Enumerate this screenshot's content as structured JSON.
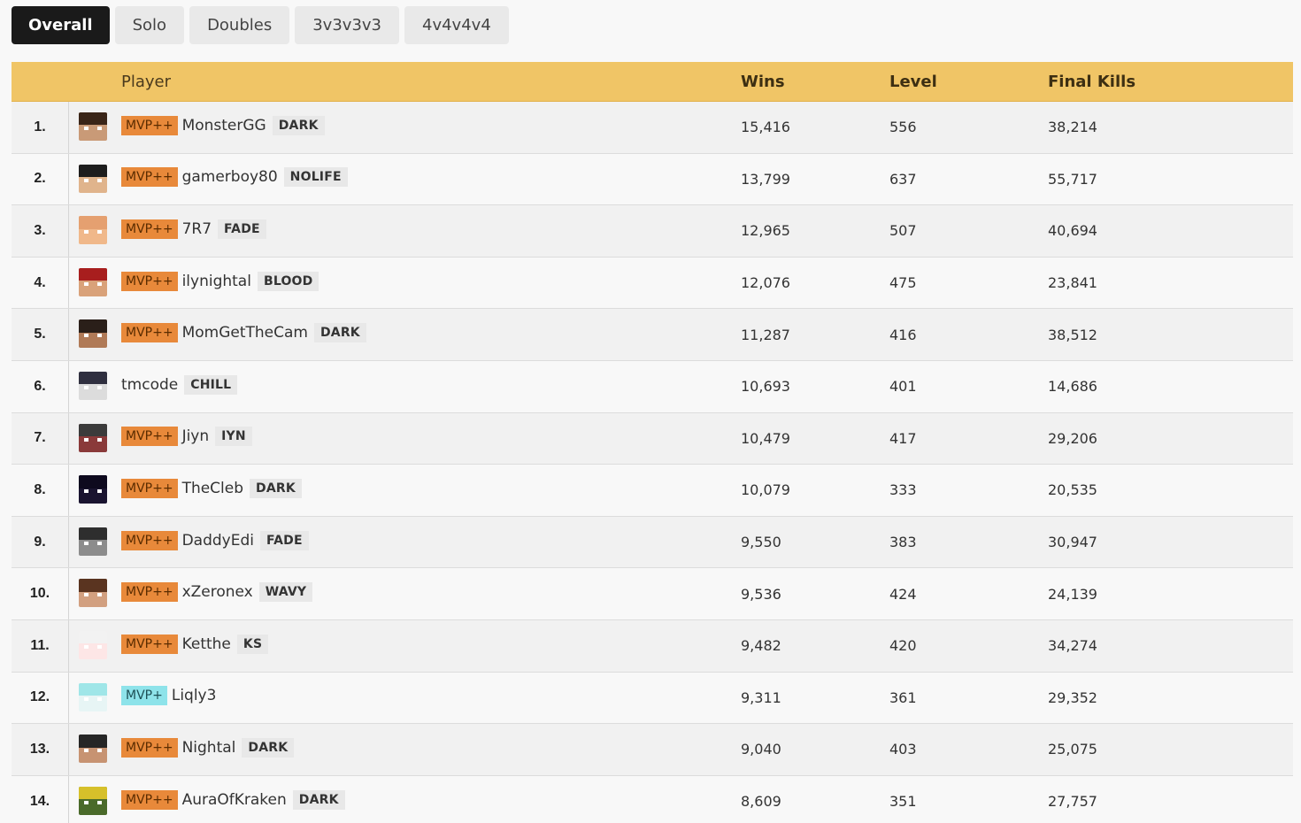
{
  "tabs": [
    "Overall",
    "Solo",
    "Doubles",
    "3v3v3v3",
    "4v4v4v4"
  ],
  "active_tab": 0,
  "headers": {
    "player": "Player",
    "wins": "Wins",
    "level": "Level",
    "final_kills": "Final Kills"
  },
  "colors": {
    "header_bg": "#f0c566",
    "mvp_plus_plus": "#e8893a",
    "mvp_plus": "#8ee3ea"
  },
  "rows": [
    {
      "rank": "1.",
      "rank_tag": "MVP++",
      "name": "MonsterGG",
      "guild": "DARK",
      "wins": "15,416",
      "level": "556",
      "final_kills": "38,214",
      "skin": [
        "#3a2518",
        "#c99a77"
      ]
    },
    {
      "rank": "2.",
      "rank_tag": "MVP++",
      "name": "gamerboy80",
      "guild": "NOLIFE",
      "wins": "13,799",
      "level": "637",
      "final_kills": "55,717",
      "skin": [
        "#1d1d1d",
        "#e0b48c"
      ]
    },
    {
      "rank": "3.",
      "rank_tag": "MVP++",
      "name": "7R7",
      "guild": "FADE",
      "wins": "12,965",
      "level": "507",
      "final_kills": "40,694",
      "skin": [
        "#e5a070",
        "#f0b88a"
      ]
    },
    {
      "rank": "4.",
      "rank_tag": "MVP++",
      "name": "ilynightal",
      "guild": "BLOOD",
      "wins": "12,076",
      "level": "475",
      "final_kills": "23,841",
      "skin": [
        "#a81e1e",
        "#d9a27a"
      ]
    },
    {
      "rank": "5.",
      "rank_tag": "MVP++",
      "name": "MomGetTheCam",
      "guild": "DARK",
      "wins": "11,287",
      "level": "416",
      "final_kills": "38,512",
      "skin": [
        "#2a1f19",
        "#b07a57"
      ]
    },
    {
      "rank": "6.",
      "rank_tag": "",
      "name": "tmcode",
      "guild": "CHILL",
      "wins": "10,693",
      "level": "401",
      "final_kills": "14,686",
      "skin": [
        "#303040",
        "#dcdcdc"
      ]
    },
    {
      "rank": "7.",
      "rank_tag": "MVP++",
      "name": "Jiyn",
      "guild": "IYN",
      "wins": "10,479",
      "level": "417",
      "final_kills": "29,206",
      "skin": [
        "#3b3b3b",
        "#8a3a3a"
      ]
    },
    {
      "rank": "8.",
      "rank_tag": "MVP++",
      "name": "TheCleb",
      "guild": "DARK",
      "wins": "10,079",
      "level": "333",
      "final_kills": "20,535",
      "skin": [
        "#0e0a1e",
        "#1a1430"
      ]
    },
    {
      "rank": "9.",
      "rank_tag": "MVP++",
      "name": "DaddyEdi",
      "guild": "FADE",
      "wins": "9,550",
      "level": "383",
      "final_kills": "30,947",
      "skin": [
        "#2e2e2e",
        "#8c8c8c"
      ]
    },
    {
      "rank": "10.",
      "rank_tag": "MVP++",
      "name": "xZeronex",
      "guild": "WAVY",
      "wins": "9,536",
      "level": "424",
      "final_kills": "24,139",
      "skin": [
        "#5a3420",
        "#d2a080"
      ]
    },
    {
      "rank": "11.",
      "rank_tag": "MVP++",
      "name": "Ketthe",
      "guild": "KS",
      "wins": "9,482",
      "level": "420",
      "final_kills": "34,274",
      "skin": [
        "#f2f2f2",
        "#fde6e6"
      ]
    },
    {
      "rank": "12.",
      "rank_tag": "MVP+",
      "name": "Liqly3",
      "guild": "",
      "wins": "9,311",
      "level": "361",
      "final_kills": "29,352",
      "skin": [
        "#9fe6e8",
        "#e7f5f5"
      ]
    },
    {
      "rank": "13.",
      "rank_tag": "MVP++",
      "name": "Nightal",
      "guild": "DARK",
      "wins": "9,040",
      "level": "403",
      "final_kills": "25,075",
      "skin": [
        "#262626",
        "#c79372"
      ]
    },
    {
      "rank": "14.",
      "rank_tag": "MVP++",
      "name": "AuraOfKraken",
      "guild": "DARK",
      "wins": "8,609",
      "level": "351",
      "final_kills": "27,757",
      "skin": [
        "#d6c02a",
        "#4a6a2a"
      ]
    }
  ]
}
